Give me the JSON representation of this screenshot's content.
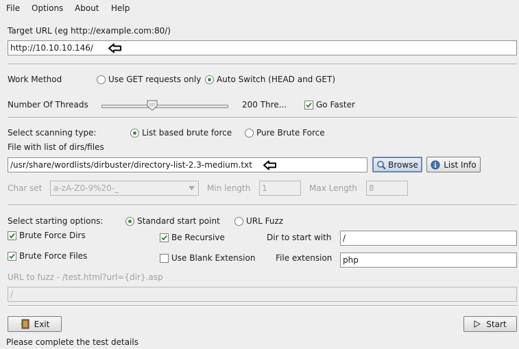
{
  "menu": [
    "File",
    "Options",
    "About",
    "Help"
  ],
  "target": {
    "label": "Target URL (eg http://example.com:80/)",
    "value": "http://10.10.10.146/"
  },
  "work_method": {
    "label": "Work Method",
    "option_get": "Use GET requests only",
    "option_auto": "Auto Switch (HEAD and GET)",
    "selected": "auto"
  },
  "threads": {
    "label": "Number Of Threads",
    "value_text": "200 Thre...",
    "slider_fraction": 0.4,
    "go_faster_label": "Go Faster",
    "go_faster_checked": true
  },
  "scan_type": {
    "label": "Select scanning type:",
    "option_list": "List based brute force",
    "option_pure": "Pure Brute Force",
    "selected": "list"
  },
  "wordlist": {
    "label": "File with list of dirs/files",
    "value": "/usr/share/wordlists/dirbuster/directory-list-2.3-medium.txt",
    "browse_label": "Browse",
    "list_info_label": "List Info"
  },
  "charset": {
    "label": "Char set",
    "value": "a-zA-Z0-9%20-_",
    "min_label": "Min length",
    "min_value": "1",
    "max_label": "Max Length",
    "max_value": "8"
  },
  "start_options": {
    "label": "Select starting options:",
    "option_standard": "Standard start point",
    "option_fuzz": "URL Fuzz",
    "selected": "standard",
    "brute_dirs_label": "Brute Force Dirs",
    "brute_dirs_checked": true,
    "brute_files_label": "Brute Force Files",
    "brute_files_checked": true,
    "recursive_label": "Be Recursive",
    "recursive_checked": true,
    "blank_ext_label": "Use Blank Extension",
    "blank_ext_checked": false,
    "dir_start_label": "Dir to start with",
    "dir_start_value": "/",
    "file_ext_label": "File extension",
    "file_ext_value": "php"
  },
  "fuzz": {
    "label": "URL to fuzz - /test.html?url={dir}.asp",
    "value": "/"
  },
  "actions": {
    "exit_label": "Exit",
    "start_label": "Start"
  },
  "status": "Please complete the test details",
  "colors": {
    "background": "#eeeeee",
    "radio_dot": "#3c8c3c",
    "check_mark": "#2e7d2e"
  }
}
